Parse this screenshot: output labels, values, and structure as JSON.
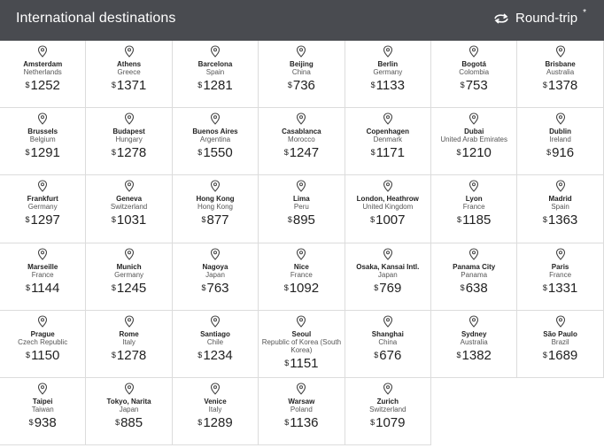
{
  "header": {
    "title": "International destinations",
    "trip_type": "Round-trip",
    "trip_mark": "*",
    "icon": "round-trip-arrows-icon"
  },
  "currency_symbol": "$",
  "destinations": [
    {
      "city": "Amsterdam",
      "country": "Netherlands",
      "price": "1252"
    },
    {
      "city": "Athens",
      "country": "Greece",
      "price": "1371"
    },
    {
      "city": "Barcelona",
      "country": "Spain",
      "price": "1281"
    },
    {
      "city": "Beijing",
      "country": "China",
      "price": "736"
    },
    {
      "city": "Berlin",
      "country": "Germany",
      "price": "1133"
    },
    {
      "city": "Bogotá",
      "country": "Colombia",
      "price": "753"
    },
    {
      "city": "Brisbane",
      "country": "Australia",
      "price": "1378"
    },
    {
      "city": "Brussels",
      "country": "Belgium",
      "price": "1291"
    },
    {
      "city": "Budapest",
      "country": "Hungary",
      "price": "1278"
    },
    {
      "city": "Buenos Aires",
      "country": "Argentina",
      "price": "1550"
    },
    {
      "city": "Casablanca",
      "country": "Morocco",
      "price": "1247"
    },
    {
      "city": "Copenhagen",
      "country": "Denmark",
      "price": "1171"
    },
    {
      "city": "Dubai",
      "country": "United Arab Emirates",
      "price": "1210"
    },
    {
      "city": "Dublin",
      "country": "Ireland",
      "price": "916"
    },
    {
      "city": "Frankfurt",
      "country": "Germany",
      "price": "1297"
    },
    {
      "city": "Geneva",
      "country": "Switzerland",
      "price": "1031"
    },
    {
      "city": "Hong Kong",
      "country": "Hong Kong",
      "price": "877"
    },
    {
      "city": "Lima",
      "country": "Peru",
      "price": "895"
    },
    {
      "city": "London, Heathrow",
      "country": "United Kingdom",
      "price": "1007"
    },
    {
      "city": "Lyon",
      "country": "France",
      "price": "1185"
    },
    {
      "city": "Madrid",
      "country": "Spain",
      "price": "1363"
    },
    {
      "city": "Marseille",
      "country": "France",
      "price": "1144"
    },
    {
      "city": "Munich",
      "country": "Germany",
      "price": "1245"
    },
    {
      "city": "Nagoya",
      "country": "Japan",
      "price": "763"
    },
    {
      "city": "Nice",
      "country": "France",
      "price": "1092"
    },
    {
      "city": "Osaka, Kansai Intl.",
      "country": "Japan",
      "price": "769"
    },
    {
      "city": "Panama City",
      "country": "Panama",
      "price": "638"
    },
    {
      "city": "Paris",
      "country": "France",
      "price": "1331"
    },
    {
      "city": "Prague",
      "country": "Czech Republic",
      "price": "1150"
    },
    {
      "city": "Rome",
      "country": "Italy",
      "price": "1278"
    },
    {
      "city": "Santiago",
      "country": "Chile",
      "price": "1234"
    },
    {
      "city": "Seoul",
      "country": "Republic of Korea (South Korea)",
      "price": "1151"
    },
    {
      "city": "Shanghai",
      "country": "China",
      "price": "676"
    },
    {
      "city": "Sydney",
      "country": "Australia",
      "price": "1382"
    },
    {
      "city": "São Paulo",
      "country": "Brazil",
      "price": "1689"
    },
    {
      "city": "Taipei",
      "country": "Taiwan",
      "price": "938"
    },
    {
      "city": "Tokyo, Narita",
      "country": "Japan",
      "price": "885"
    },
    {
      "city": "Venice",
      "country": "Italy",
      "price": "1289"
    },
    {
      "city": "Warsaw",
      "country": "Poland",
      "price": "1136"
    },
    {
      "city": "Zurich",
      "country": "Switzerland",
      "price": "1079"
    }
  ]
}
